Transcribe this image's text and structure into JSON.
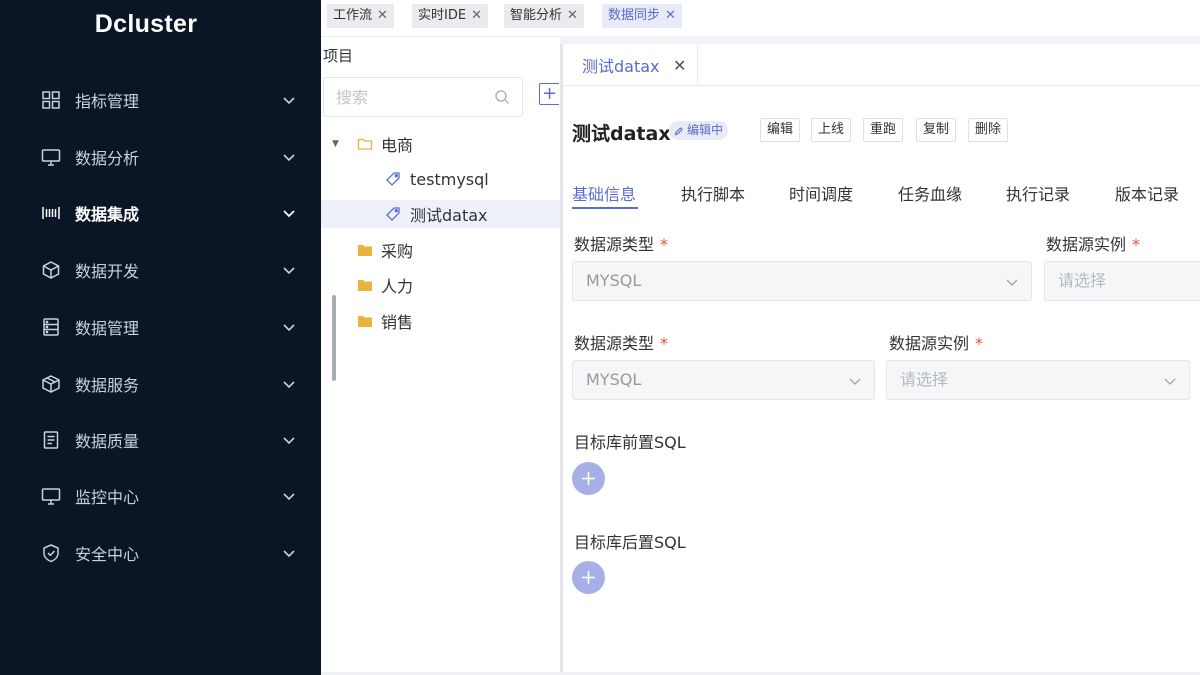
{
  "app": {
    "logo": "Dcluster"
  },
  "sidebar": {
    "items": [
      {
        "label": "指标管理",
        "icon": "grid-icon",
        "active": false
      },
      {
        "label": "数据分析",
        "icon": "monitor-icon",
        "active": false
      },
      {
        "label": "数据集成",
        "icon": "barcode-icon",
        "active": true
      },
      {
        "label": "数据开发",
        "icon": "cube-icon",
        "active": false
      },
      {
        "label": "数据管理",
        "icon": "server-icon",
        "active": false
      },
      {
        "label": "数据服务",
        "icon": "box-icon",
        "active": false
      },
      {
        "label": "数据质量",
        "icon": "document-icon",
        "active": false
      },
      {
        "label": "监控中心",
        "icon": "monitor-icon",
        "active": false
      },
      {
        "label": "安全中心",
        "icon": "shield-icon",
        "active": false
      }
    ]
  },
  "top_tabs": [
    {
      "label": "工作流",
      "active": false
    },
    {
      "label": "实时IDE",
      "active": false
    },
    {
      "label": "智能分析",
      "active": false
    },
    {
      "label": "数据同步",
      "active": true
    }
  ],
  "tree": {
    "title": "项目",
    "search_placeholder": "搜索",
    "nodes": [
      {
        "label": "电商",
        "type": "folder-open",
        "expanded": true
      },
      {
        "label": "testmysql",
        "type": "task"
      },
      {
        "label": "测试datax",
        "type": "task",
        "selected": true
      },
      {
        "label": "采购",
        "type": "folder"
      },
      {
        "label": "人力",
        "type": "folder"
      },
      {
        "label": "销售",
        "type": "folder"
      }
    ]
  },
  "doc_tab": {
    "label": "测试datax"
  },
  "editor": {
    "title": "测试datax",
    "status": "编辑中",
    "actions": [
      "编辑",
      "上线",
      "重跑",
      "复制",
      "删除"
    ],
    "section_tabs": [
      "基础信息",
      "执行脚本",
      "时间调度",
      "任务血缘",
      "执行记录",
      "版本记录"
    ],
    "active_section": "基础信息",
    "row1": {
      "source_type_label": "数据源类型",
      "source_type_value": "MYSQL",
      "source_instance_label": "数据源实例",
      "source_instance_placeholder": "请选择"
    },
    "row2": {
      "source_type_label": "数据源类型",
      "source_type_value": "MYSQL",
      "source_instance_label": "数据源实例",
      "source_instance_placeholder": "请选择"
    },
    "required_mark": "*",
    "pre_sql_label": "目标库前置SQL",
    "post_sql_label": "目标库后置SQL"
  },
  "colors": {
    "sidebar_bg": "#0a1526",
    "accent": "#5b6cd0",
    "required": "#e74c3c",
    "plus_button": "#a6b0e6"
  }
}
